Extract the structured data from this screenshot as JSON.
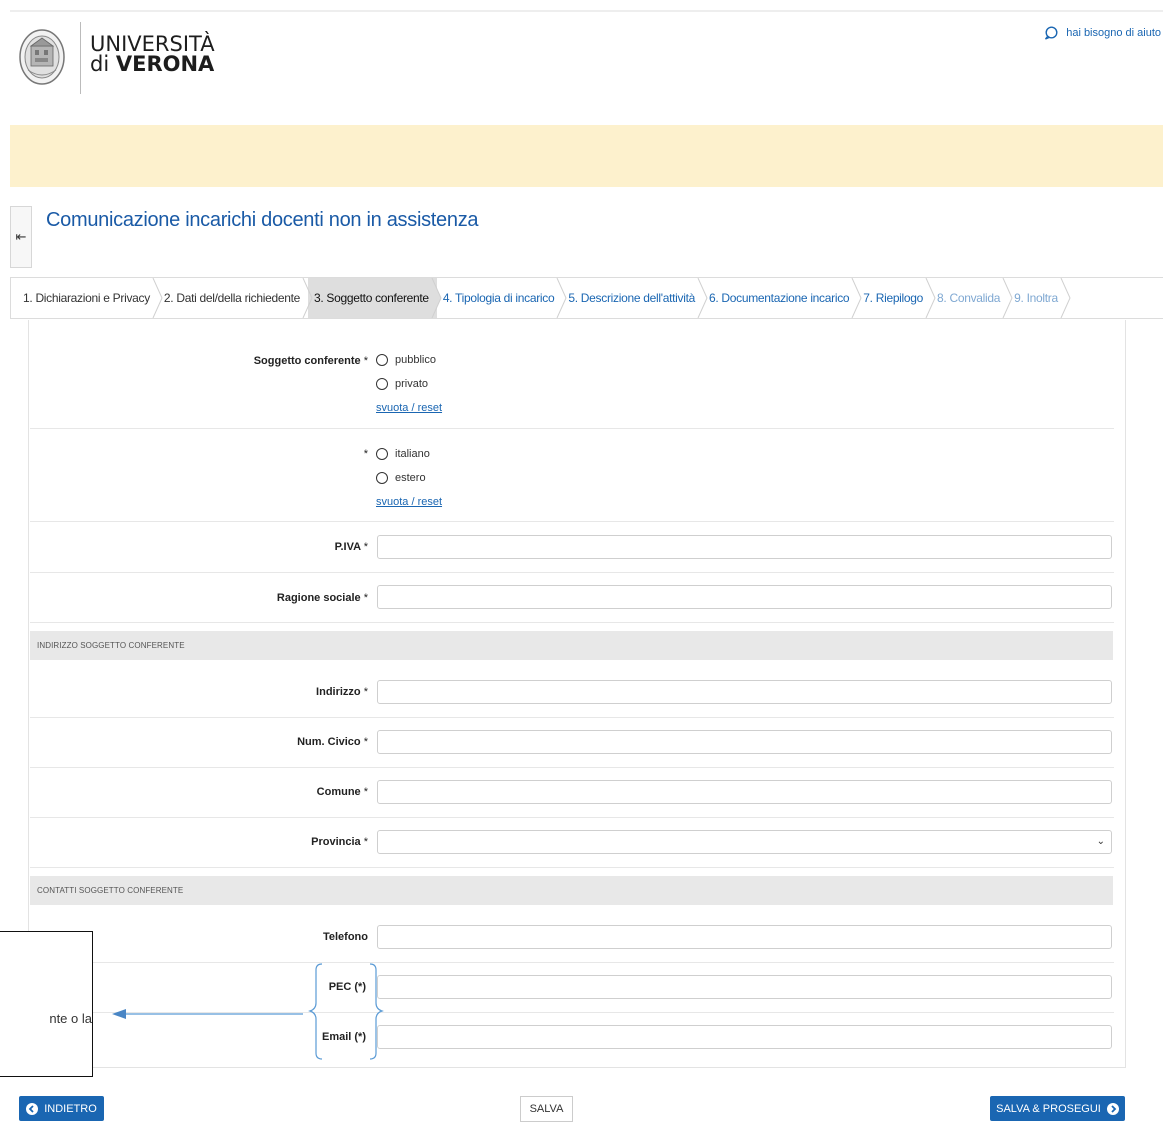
{
  "header": {
    "brand_line1": "UNIVERSITÀ",
    "brand_line2_prefix": "di ",
    "brand_line2_bold": "VERONA",
    "help_link": "hai bisogno di aiuto"
  },
  "page": {
    "title": "Comunicazione incarichi docenti non in assistenza"
  },
  "steps": [
    {
      "label": "1. Dichiarazioni e Privacy",
      "state": "done"
    },
    {
      "label": "2. Dati del/della richiedente",
      "state": "done"
    },
    {
      "label": "3. Soggetto conferente",
      "state": "active"
    },
    {
      "label": "4. Tipologia di incarico",
      "state": "next"
    },
    {
      "label": "5. Descrizione dell'attività",
      "state": "next"
    },
    {
      "label": "6. Documentazione incarico",
      "state": "next"
    },
    {
      "label": "7. Riepilogo",
      "state": "next"
    },
    {
      "label": "8. Convalida",
      "state": "disabled"
    },
    {
      "label": "9. Inoltra",
      "state": "disabled"
    }
  ],
  "form": {
    "soggetto_label": "Soggetto conferente",
    "required_mark": "*",
    "soggetto_options": [
      "pubblico",
      "privato"
    ],
    "reset_label": "svuota / reset",
    "nazionalita_options": [
      "italiano",
      "estero"
    ],
    "piva_label": "P.IVA",
    "ragione_label": "Ragione sociale",
    "section_indirizzo": "INDIRIZZO SOGGETTO CONFERENTE",
    "indirizzo_label": "Indirizzo",
    "civico_label": "Num. Civico",
    "comune_label": "Comune",
    "provincia_label": "Provincia",
    "section_contatti": "CONTATTI SOGGETTO CONFERENTE",
    "telefono_label": "Telefono",
    "pec_label": "PEC (*)",
    "email_label": "Email (*)"
  },
  "annotation": {
    "text": "nte o la"
  },
  "buttons": {
    "back": "INDIETRO",
    "save": "SALVA",
    "next": "SALVA & PROSEGUI"
  },
  "colors": {
    "accent": "#1a66b2",
    "banner": "#fdf1cd"
  }
}
